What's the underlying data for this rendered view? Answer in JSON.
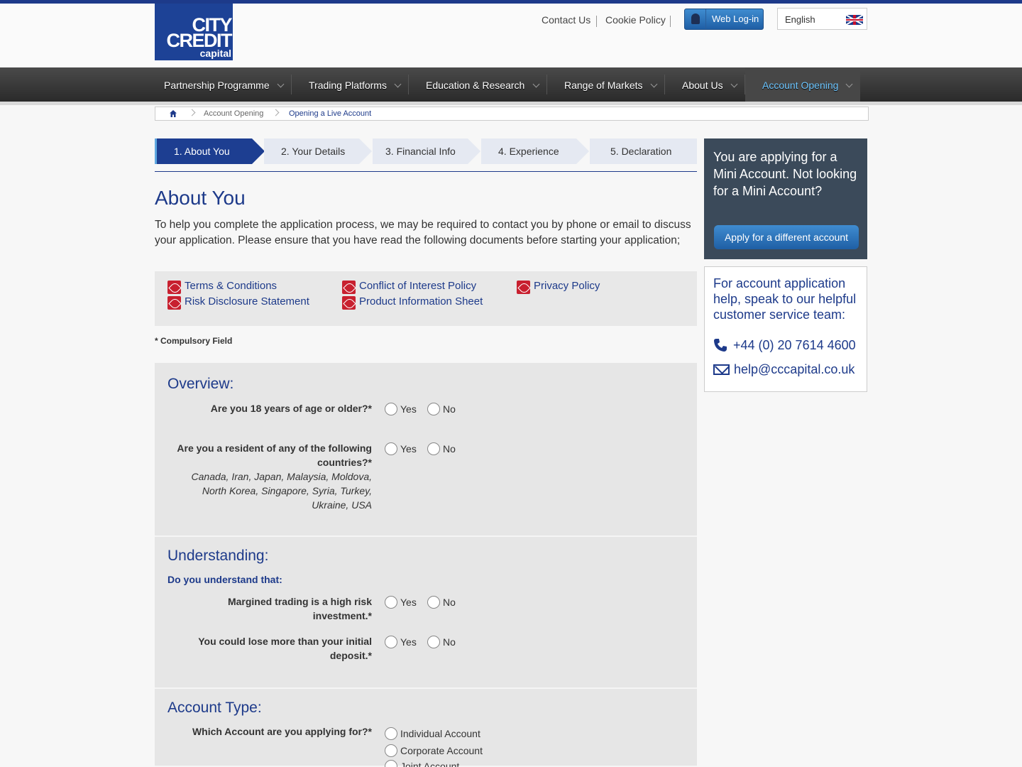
{
  "logo": {
    "line1": "CITY",
    "line2": "CREDIT",
    "line3": "capital"
  },
  "header": {
    "links": [
      "Contact Us",
      "Cookie Policy"
    ],
    "web_login": "Web Log-in",
    "language": "English"
  },
  "nav": {
    "items": [
      {
        "label": "Partnership Programme"
      },
      {
        "label": "Trading Platforms"
      },
      {
        "label": "Education & Research"
      },
      {
        "label": "Range of Markets"
      },
      {
        "label": "About Us"
      },
      {
        "label": "Account Opening"
      }
    ],
    "active": "Account Opening"
  },
  "breadcrumb": [
    "Account Opening",
    "Opening a Live Account"
  ],
  "steps": [
    "1. About You",
    "2. Your Details",
    "3. Financial Info",
    "4. Experience",
    "5. Declaration"
  ],
  "main": {
    "title": "About You",
    "intro": "To help you complete the application process, we may be required to contact you by phone or email to discuss your application. Please ensure that you have read the following documents before starting your application;",
    "documents": [
      "Terms & Conditions",
      "Risk Disclosure Statement",
      "Conflict of Interest Policy",
      "Product Information Sheet",
      "Privacy Policy"
    ],
    "compulsory": "* Compulsory Field"
  },
  "overview": {
    "heading": "Overview:",
    "q1": "Are you 18 years of age or older?*",
    "q2": "Are you a resident of any of the following countries?*",
    "q2_note": "Canada, Iran, Japan, Malaysia, Moldova, North Korea, Singapore, Syria, Turkey, Ukraine, USA",
    "yes": "Yes",
    "no": "No"
  },
  "understanding": {
    "heading": "Understanding:",
    "subheading": "Do you understand that:",
    "q1": "Margined trading is a high risk investment.*",
    "q2": "You could lose more than your initial deposit.*"
  },
  "account_type": {
    "heading": "Account Type:",
    "question": "Which Account are you applying for?*",
    "options": [
      "Individual Account",
      "Corporate Account",
      "Joint Account"
    ]
  },
  "sidebar": {
    "applying_text": "You are applying for a Mini Account. Not looking for a Mini Account?",
    "apply_button": "Apply for a different account",
    "help_text": "For account application help, speak to our helpful customer service team:",
    "phone": "+44 (0) 20 7614 4600",
    "email": "help@cccapital.co.uk"
  }
}
